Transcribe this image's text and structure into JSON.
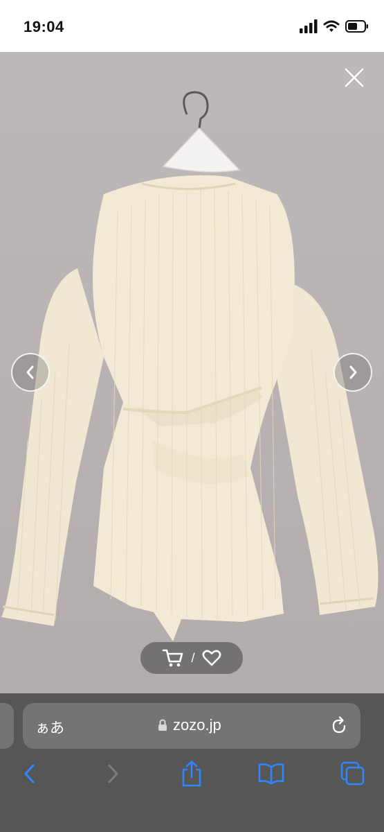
{
  "status_bar": {
    "time": "19:04",
    "icons": [
      "cellular-signal-icon",
      "wifi-icon",
      "battery-icon"
    ]
  },
  "viewer": {
    "image": "cream ribbed long-sleeve top with wrap back detail on a hanger",
    "close_icon": "close-icon",
    "prev_icon": "chevron-left-icon",
    "next_icon": "chevron-right-icon",
    "actions": {
      "cart_icon": "cart-icon",
      "separator": "/",
      "favorite_icon": "heart-icon"
    }
  },
  "browser": {
    "text_size_label": "ぁあ",
    "url": "zozo.jp",
    "lock_icon": "lock-icon",
    "reload_icon": "reload-icon",
    "toolbar": [
      "back-icon",
      "forward-icon",
      "share-icon",
      "bookmarks-icon",
      "tabs-icon"
    ]
  },
  "colors": {
    "background": "#bbb6b7",
    "garment": "#f3ead6",
    "browser_bar": "#565656",
    "address_bar": "#747474",
    "accent_blue": "#2f86ff"
  }
}
